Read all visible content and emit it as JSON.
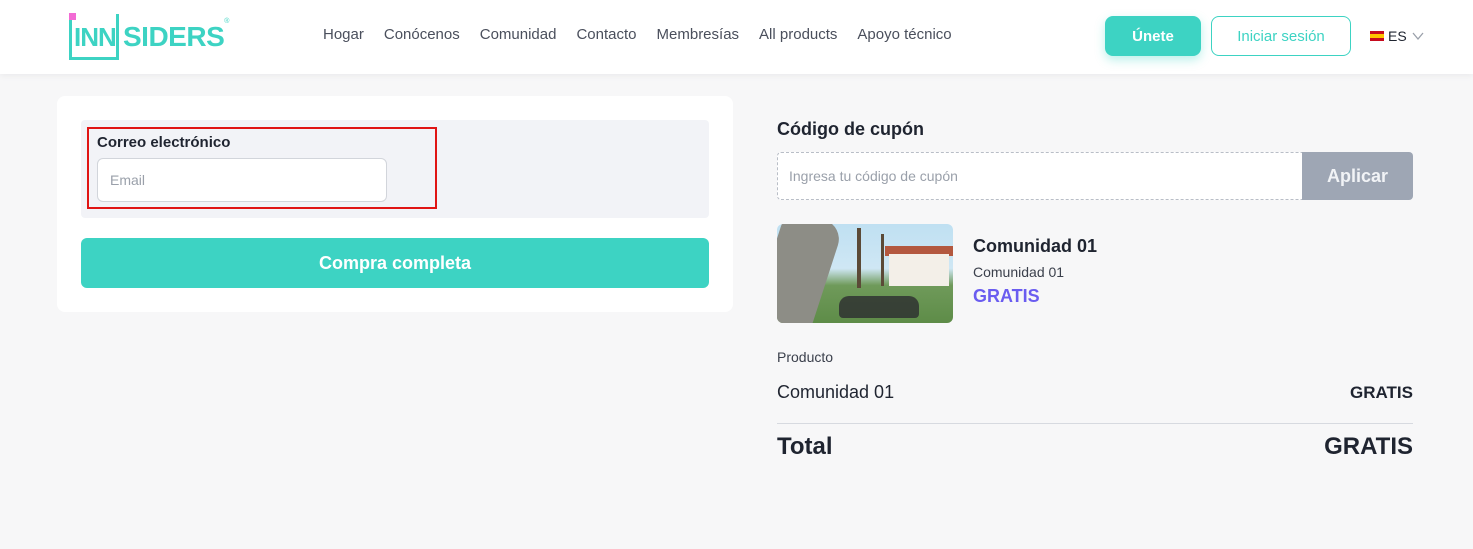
{
  "header": {
    "logo": {
      "prefix": "INN",
      "text": "SIDERS",
      "reg": "®"
    },
    "nav": [
      {
        "label": "Hogar"
      },
      {
        "label": "Conócenos"
      },
      {
        "label": "Comunidad"
      },
      {
        "label": "Contacto"
      },
      {
        "label": "Membresías"
      },
      {
        "label": "All products"
      },
      {
        "label": "Apoyo técnico"
      }
    ],
    "join_label": "Únete",
    "login_label": "Iniciar sesión",
    "language": {
      "code": "ES",
      "flag_icon": "spain-flag-icon"
    }
  },
  "checkout": {
    "email_label": "Correo electrónico",
    "email_placeholder": "Email",
    "email_value": "",
    "complete_label": "Compra completa"
  },
  "coupon": {
    "label": "Código de cupón",
    "placeholder": "Ingresa tu código de cupón",
    "apply_label": "Aplicar"
  },
  "product": {
    "title": "Comunidad 01",
    "subtitle": "Comunidad 01",
    "price": "GRATIS"
  },
  "summary": {
    "header": "Producto",
    "item_name": "Comunidad 01",
    "item_price": "GRATIS",
    "total_label": "Total",
    "total_value": "GRATIS"
  },
  "colors": {
    "brand": "#3dd3c3",
    "accent_purple": "#6a5cf0",
    "highlight_red": "#e01414",
    "apply_disabled": "#9ea6b4"
  }
}
